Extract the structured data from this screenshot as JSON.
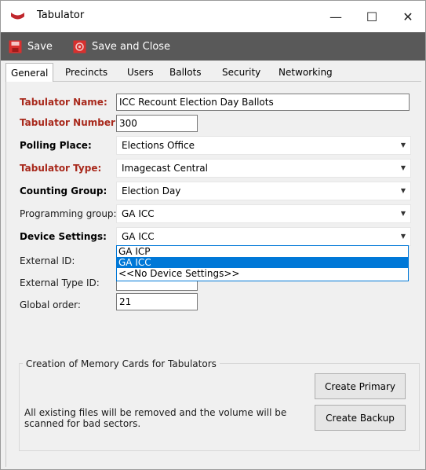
{
  "window": {
    "title": "Tabulator",
    "minimize_glyph": "—",
    "maximize_glyph": "☐",
    "close_glyph": "✕"
  },
  "toolbar": {
    "save_label": "Save",
    "save_close_label": "Save and Close",
    "save_icon": "floppy-disk-icon",
    "save_close_icon": "save-close-icon",
    "accent_color": "#d9302e"
  },
  "tabs": [
    {
      "label": "General",
      "active": true
    },
    {
      "label": "Precincts",
      "active": false
    },
    {
      "label": "Users",
      "active": false
    },
    {
      "label": "Ballots",
      "active": false
    },
    {
      "label": "Security",
      "active": false
    },
    {
      "label": "Networking",
      "active": false
    }
  ],
  "form": {
    "tabulator_name": {
      "label": "Tabulator Name:",
      "value": "ICC Recount Election Day Ballots"
    },
    "tabulator_number": {
      "label": "Tabulator Number:",
      "value": "300"
    },
    "polling_place": {
      "label": "Polling Place:",
      "value": "Elections Office"
    },
    "tabulator_type": {
      "label": "Tabulator Type:",
      "value": "Imagecast Central"
    },
    "counting_group": {
      "label": "Counting Group:",
      "value": "Election Day"
    },
    "programming_group": {
      "label": "Programming group:",
      "value": "GA ICC"
    },
    "device_settings": {
      "label": "Device Settings:",
      "value": "GA ICC",
      "options": [
        "GA ICP",
        "GA ICC",
        "<<No Device Settings>>"
      ],
      "highlighted": "GA ICC"
    },
    "external_id": {
      "label": "External ID:",
      "value": ""
    },
    "external_type_id": {
      "label": "External Type ID:",
      "value": ""
    },
    "global_order": {
      "label": "Global order:",
      "value": "21"
    }
  },
  "memory_cards": {
    "group_title": "Creation of Memory Cards for Tabulators",
    "create_primary_label": "Create Primary",
    "create_backup_label": "Create Backup",
    "note": "All existing files will be removed and the volume will be scanned for bad sectors."
  },
  "colors": {
    "required_label": "#a8291c",
    "toolbar_bg": "#595959",
    "selection": "#0078d7"
  }
}
